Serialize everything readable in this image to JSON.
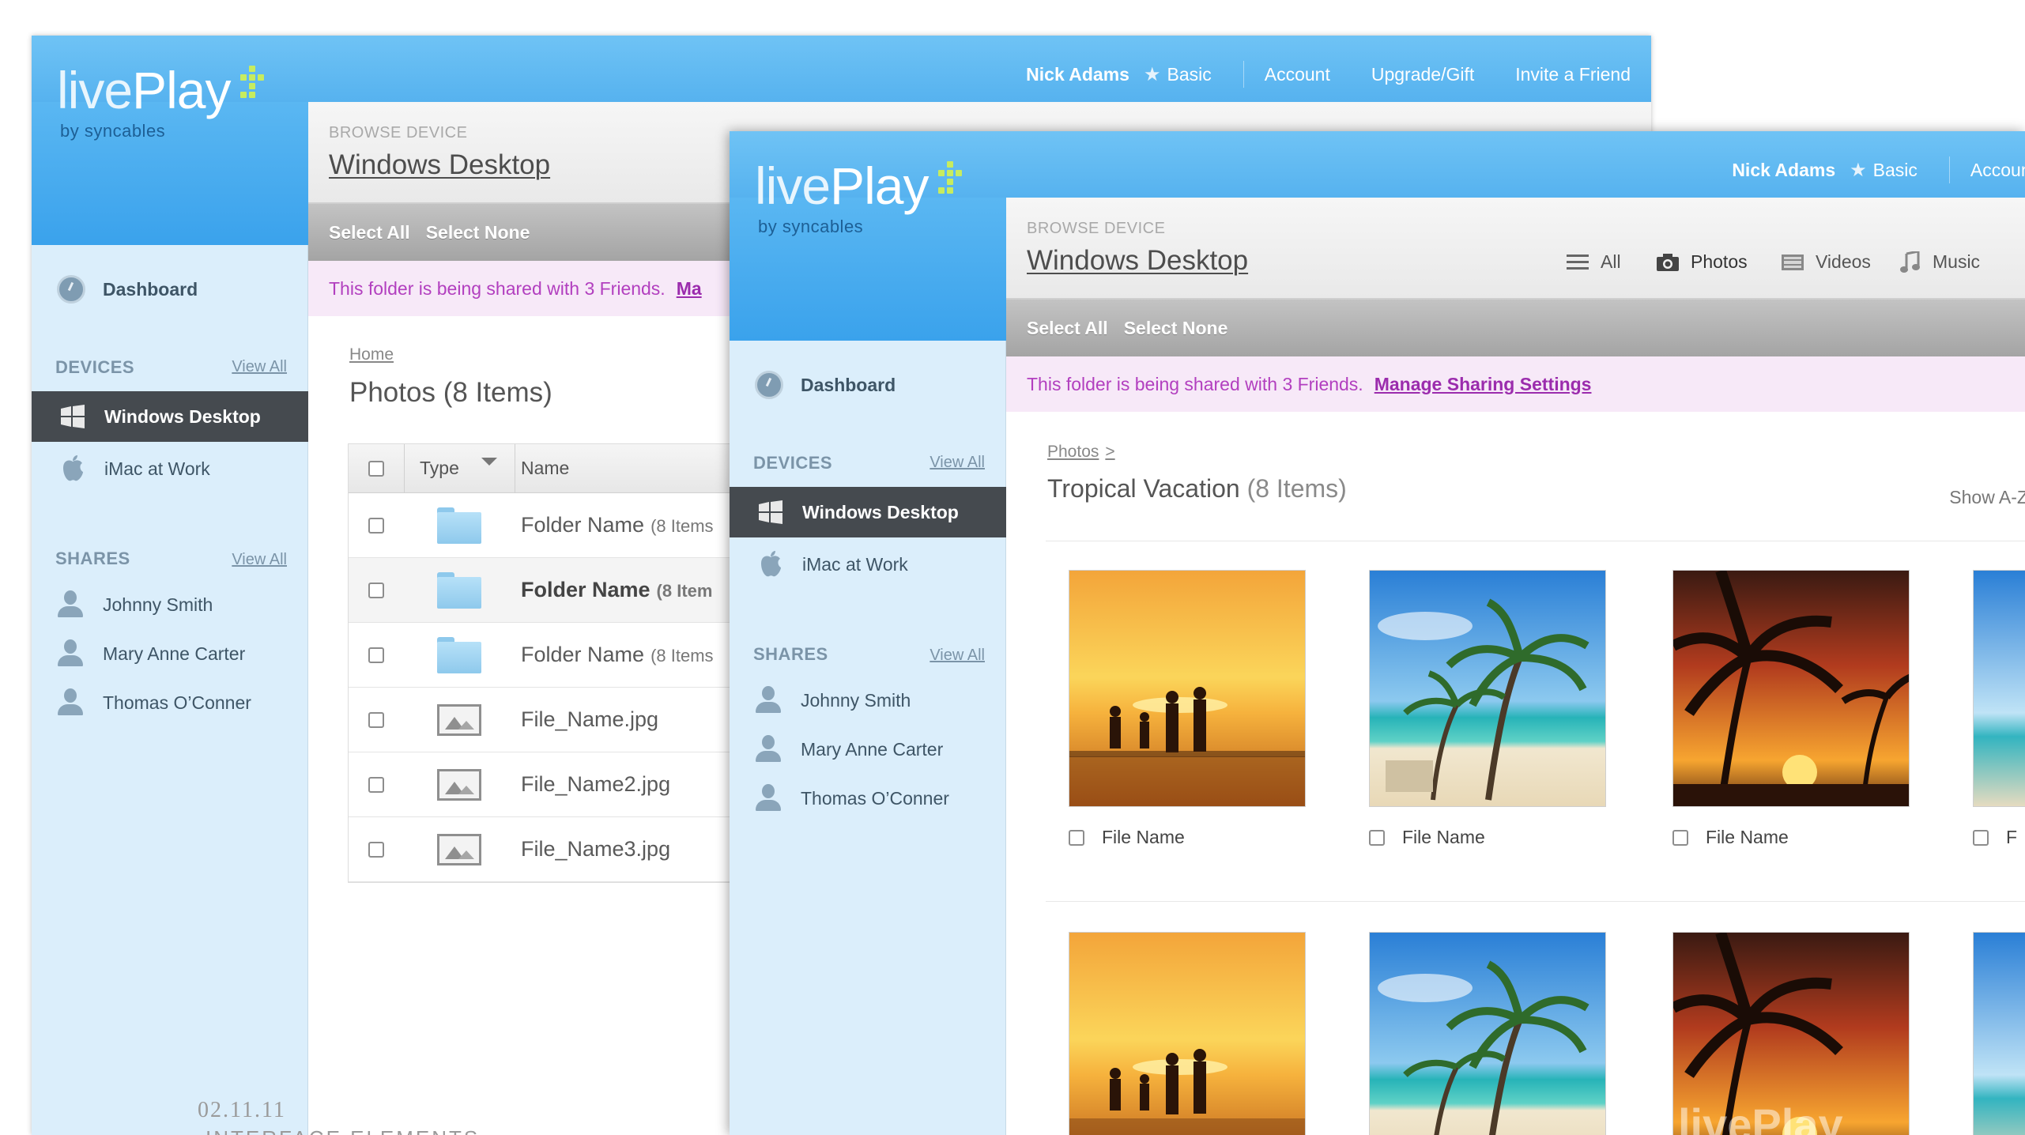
{
  "app": {
    "logo_live": "live",
    "logo_play": "Play",
    "logo_by": "by syncables",
    "accent_color": "#56b2ef",
    "logo_dot_color": "#c7ec5f"
  },
  "topnav": {
    "user": "Nick Adams",
    "plan": "Basic",
    "account": "Account",
    "upgrade": "Upgrade/Gift",
    "invite": "Invite a Friend"
  },
  "sidebar": {
    "dashboard": "Dashboard",
    "devices_heading": "DEVICES",
    "devices_view_all": "View All",
    "devices": [
      {
        "label": "Windows Desktop",
        "icon": "windows-icon",
        "active": true
      },
      {
        "label": "iMac at Work",
        "icon": "apple-icon",
        "active": false
      }
    ],
    "shares_heading": "SHARES",
    "shares_view_all": "View All",
    "shares": [
      {
        "label": "Johnny Smith"
      },
      {
        "label": "Mary Anne Carter"
      },
      {
        "label": "Thomas O’Conner"
      }
    ]
  },
  "main": {
    "kicker": "BROWSE DEVICE",
    "title": "Windows Desktop",
    "select_all": "Select All",
    "select_none": "Select None",
    "share_note": "This folder is being shared with 3 Friends.",
    "share_link": "Manage Sharing Settings",
    "share_link_truncated": "Ma",
    "filters": [
      {
        "label": "All",
        "icon": "list-icon"
      },
      {
        "label": "Photos",
        "icon": "camera-icon"
      },
      {
        "label": "Videos",
        "icon": "film-icon"
      },
      {
        "label": "Music",
        "icon": "music-note-icon"
      }
    ]
  },
  "list_view": {
    "breadcrumb": "Home",
    "section_title": "Photos (8 Items)",
    "columns": [
      "Type",
      "Name"
    ],
    "rows": [
      {
        "kind": "folder",
        "name": "Folder Name",
        "meta": "(8 Items"
      },
      {
        "kind": "folder",
        "name": "Folder Name",
        "meta": "(8 Item"
      },
      {
        "kind": "folder",
        "name": "Folder Name",
        "meta": "(8 Items"
      },
      {
        "kind": "image",
        "name": "File_Name.jpg",
        "meta": ""
      },
      {
        "kind": "image",
        "name": "File_Name2.jpg",
        "meta": ""
      },
      {
        "kind": "image",
        "name": "File_Name3.jpg",
        "meta": ""
      }
    ]
  },
  "grid_view": {
    "breadcrumb": "Photos",
    "breadcrumb_sep": ">",
    "section_title": "Tropical Vacation",
    "section_count": "(8 Items)",
    "sort": "Show A-Z",
    "file_label": "File Name",
    "file_label_truncated": "F",
    "watermark": "livePlay"
  },
  "footer": {
    "date": "02.11.11",
    "caption": "INTERFACE ELEMENTS"
  }
}
